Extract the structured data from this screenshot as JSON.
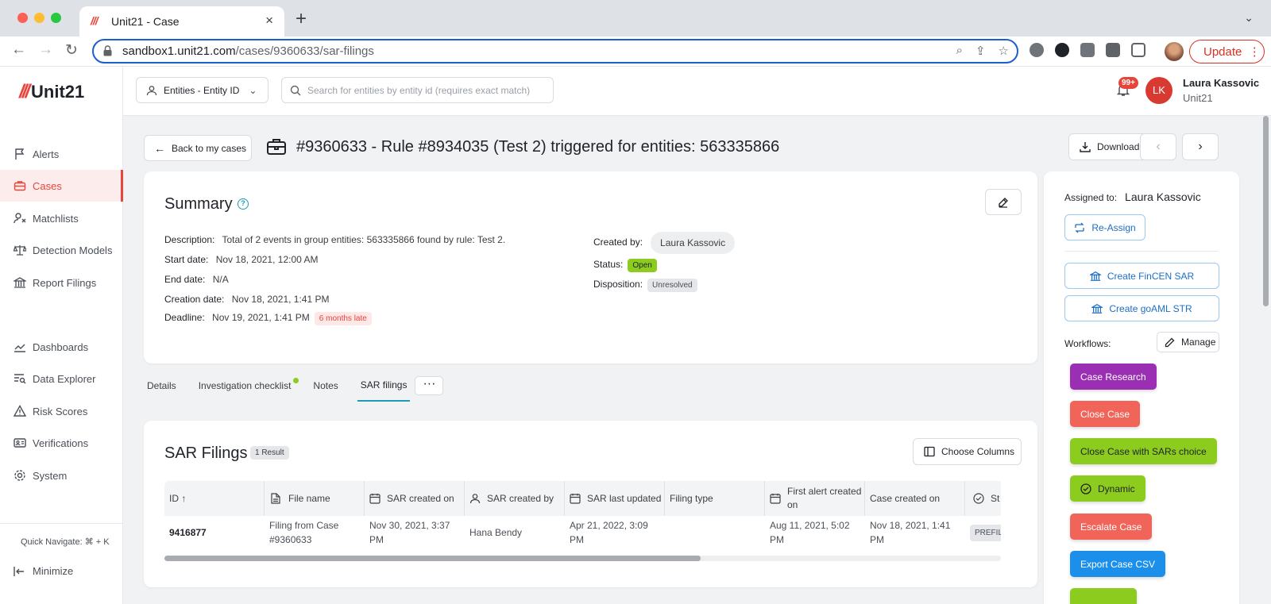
{
  "browser": {
    "tab_title": "Unit21 - Case",
    "tab_logo": "///",
    "url_host": "sandbox1.unit21.com",
    "url_path": "/cases/9360633/sar-filings",
    "update_label": "Update"
  },
  "sidebar": {
    "logo_text": "Unit21",
    "items": [
      {
        "label": "Alerts",
        "icon": "flag-icon"
      },
      {
        "label": "Cases",
        "icon": "briefcase-icon"
      },
      {
        "label": "Matchlists",
        "icon": "user-x-icon"
      },
      {
        "label": "Detection Models",
        "icon": "scale-icon"
      },
      {
        "label": "Report Filings",
        "icon": "bank-icon"
      },
      {
        "label": "Dashboards",
        "icon": "chart-line-icon"
      },
      {
        "label": "Data Explorer",
        "icon": "search-table-icon"
      },
      {
        "label": "Risk Scores",
        "icon": "warning-icon"
      },
      {
        "label": "Verifications",
        "icon": "id-card-icon"
      },
      {
        "label": "System",
        "icon": "gear-icon"
      }
    ],
    "quick_navigate": "Quick Navigate: ⌘ + K",
    "minimize": "Minimize"
  },
  "topbar": {
    "entity_select": "Entities - Entity ID",
    "search_placeholder": "Search for entities by entity id (requires exact match)",
    "notif_count": "99+",
    "user_initials": "LK",
    "user_name": "Laura Kassovic",
    "user_org": "Unit21"
  },
  "header": {
    "back_label": "Back to my cases",
    "case_title": "#9360633 - Rule #8934035 (Test 2) triggered for entities: 563335866",
    "download_label": "Download",
    "prev": "‹",
    "next": "›"
  },
  "summary": {
    "title": "Summary",
    "description_label": "Description:",
    "description": "Total of 2 events in group entities: 563335866 found by rule: Test 2.",
    "start_label": "Start date:",
    "start": "Nov 18, 2021, 12:00 AM",
    "end_label": "End date:",
    "end": "N/A",
    "creation_label": "Creation date:",
    "creation": "Nov 18, 2021, 1:41 PM",
    "deadline_label": "Deadline:",
    "deadline": "Nov 19, 2021, 1:41 PM",
    "late": "6 months late",
    "created_by_label": "Created by:",
    "created_by": "Laura Kassovic",
    "status_label": "Status:",
    "status": "Open",
    "disposition_label": "Disposition:",
    "disposition": "Unresolved"
  },
  "tabs": [
    {
      "label": "Details"
    },
    {
      "label": "Investigation checklist"
    },
    {
      "label": "Notes"
    },
    {
      "label": "SAR filings"
    }
  ],
  "tabs_more": "···",
  "sar": {
    "title": "SAR Filings",
    "result_count": "1 Result",
    "choose_columns": "Choose Columns",
    "columns": {
      "id": "ID ↑",
      "file_name": "File name",
      "sar_created_on": "SAR created on",
      "sar_created_by": "SAR created by",
      "sar_last_updated": "SAR last updated",
      "filing_type": "Filing type",
      "first_alert": "First alert created on",
      "case_created": "Case created on",
      "status": "St"
    },
    "row": {
      "id": "9416877",
      "file_name": "Filing from Case #9360633",
      "sar_created_on": "Nov 30, 2021, 3:37 PM",
      "sar_created_by": "Hana Bendy",
      "sar_last_updated": "Apr 21, 2022, 3:09 PM",
      "filing_type": "",
      "first_alert": "Aug 11, 2021, 5:02 PM",
      "case_created": "Nov 18, 2021, 1:41 PM",
      "status": "PREFIL"
    }
  },
  "right_panel": {
    "assigned_label": "Assigned to:",
    "assigned_name": "Laura Kassovic",
    "reassign": "Re-Assign",
    "create_fincen": "Create FinCEN SAR",
    "create_goaml": "Create goAML STR",
    "workflows_label": "Workflows:",
    "manage": "Manage",
    "workflows": [
      {
        "label": "Case Research",
        "color": "#9b2fb4",
        "text": "#ffffff"
      },
      {
        "label": "Close Case",
        "color": "#f0645a",
        "text": "#ffffff"
      },
      {
        "label": "Close Case with SARs choice",
        "color": "#8ccc1e",
        "text": "#1f2329"
      },
      {
        "label": "Dynamic",
        "color": "#8ccc1e",
        "text": "#1f2329"
      },
      {
        "label": "Escalate Case",
        "color": "#f0645a",
        "text": "#ffffff"
      },
      {
        "label": "Export Case CSV",
        "color": "#1b8fea",
        "text": "#ffffff"
      }
    ]
  },
  "colors": {
    "accent": "#e8443a",
    "teal": "#1f9bb5",
    "link_blue": "#1d6fc5"
  }
}
